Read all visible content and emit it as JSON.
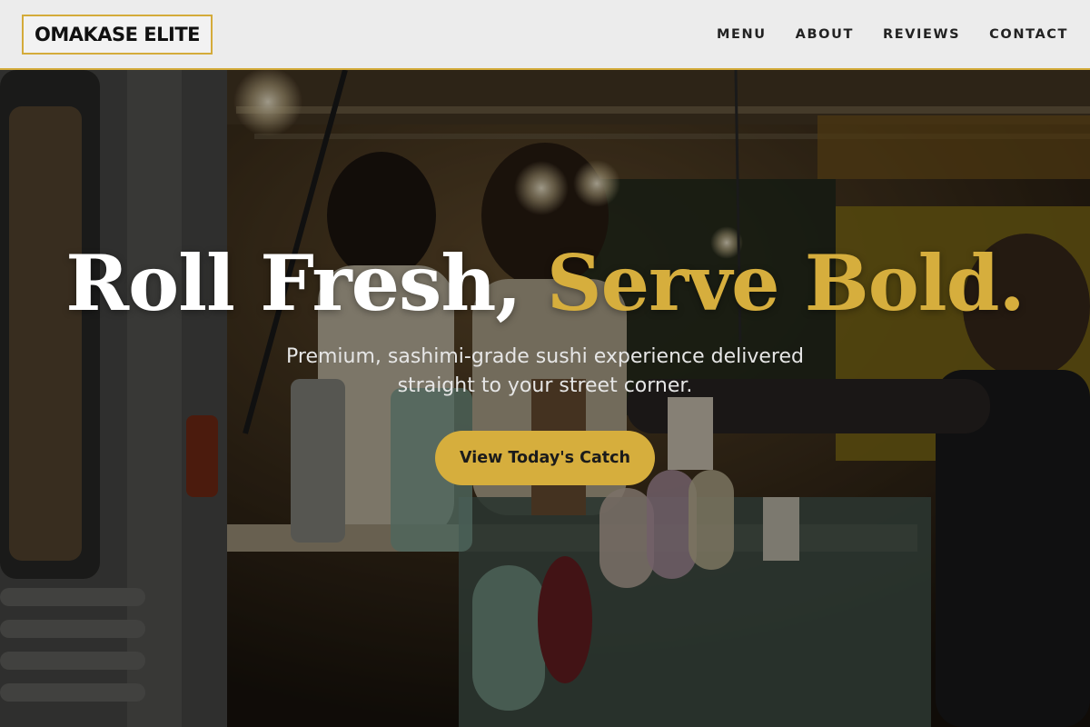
{
  "header": {
    "logo": "OMAKASE ELITE",
    "nav": [
      "MENU",
      "ABOUT",
      "REVIEWS",
      "CONTACT"
    ]
  },
  "hero": {
    "headline_main": "Roll Fresh,",
    "headline_accent": "Serve Bold.",
    "subhead": "Premium, sashimi-grade sushi experience delivered straight to your street corner.",
    "cta_label": "View Today's Catch",
    "background": "food-truck-photo"
  },
  "colors": {
    "accent": "#d6ae3d",
    "header_bg": "#ececec",
    "text_dark": "#111111"
  }
}
